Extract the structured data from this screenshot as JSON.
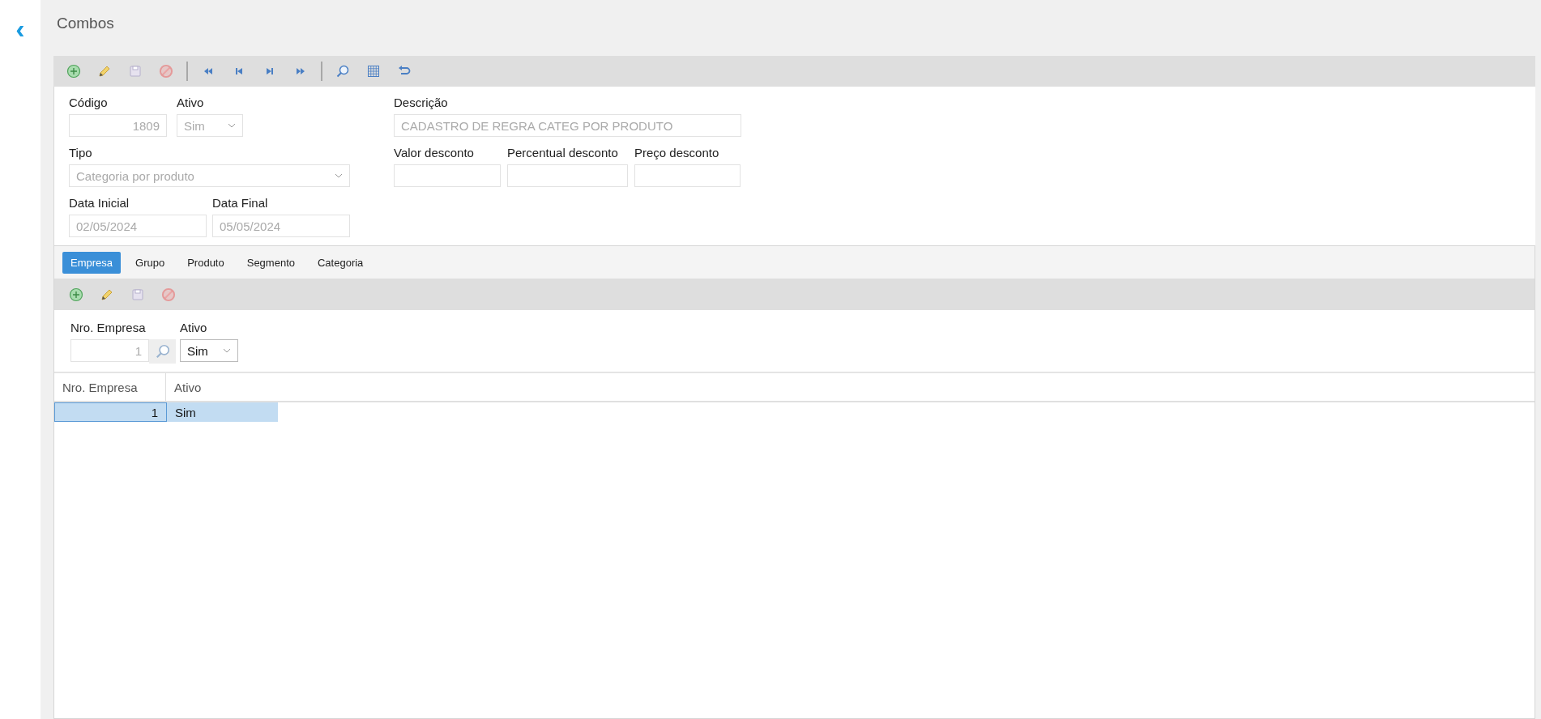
{
  "page": {
    "title": "Combos",
    "back_button": "‹"
  },
  "toolbar": [
    {
      "kind": "add"
    },
    {
      "kind": "edit"
    },
    {
      "kind": "save"
    },
    {
      "kind": "cancel"
    },
    {
      "kind": "separator"
    },
    {
      "kind": "first"
    },
    {
      "kind": "prev"
    },
    {
      "kind": "next"
    },
    {
      "kind": "last"
    },
    {
      "kind": "separator"
    },
    {
      "kind": "search"
    },
    {
      "kind": "grid"
    },
    {
      "kind": "undo"
    }
  ],
  "form": {
    "left_rows": [
      [
        {
          "label": "Código",
          "kind": "number",
          "value": "1809",
          "disabled": true
        },
        {
          "label": "Ativo",
          "kind": "select",
          "value": "Sim",
          "disabled": true
        }
      ],
      [
        {
          "label": "Tipo",
          "kind": "select",
          "value": "Categoria por produto",
          "disabled": true
        }
      ],
      [
        {
          "label": "Data Inicial",
          "kind": "text",
          "value": "02/05/2024",
          "disabled": true
        },
        {
          "label": "Data Final",
          "kind": "text",
          "value": "05/05/2024",
          "disabled": true
        }
      ]
    ],
    "right_rows": [
      [
        {
          "label": "Descrição",
          "kind": "text",
          "value": "CADASTRO DE REGRA CATEG POR PRODUTO",
          "disabled": true
        }
      ],
      [
        {
          "label": "Valor desconto",
          "kind": "number",
          "disabled": true
        },
        {
          "label": "Percentual desconto",
          "kind": "number",
          "disabled": true
        },
        {
          "label": "Preço desconto",
          "kind": "number",
          "disabled": true
        }
      ]
    ]
  },
  "tabs": [
    {
      "label": "Empresa",
      "selected": true
    },
    {
      "label": "Grupo",
      "selected": false
    },
    {
      "label": "Produto",
      "selected": false
    },
    {
      "label": "Segmento",
      "selected": false
    },
    {
      "label": "Categoria",
      "selected": false
    }
  ],
  "sub_toolbar": [
    {
      "kind": "add"
    },
    {
      "kind": "edit"
    },
    {
      "kind": "save"
    },
    {
      "kind": "cancel"
    }
  ],
  "sub_form": [
    {
      "label": "Nro. Empresa",
      "kind": "lookup",
      "value": "1",
      "disabled": true
    },
    {
      "label": "Ativo",
      "kind": "select",
      "value": "Sim",
      "disabled": false
    }
  ],
  "table": {
    "columns": [
      "Nro. Empresa",
      "Ativo"
    ],
    "rows": [
      {
        "cells": [
          "1",
          "Sim"
        ],
        "selected": true
      }
    ]
  }
}
